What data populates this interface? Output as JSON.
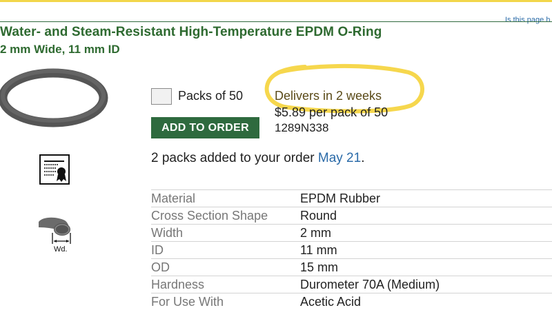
{
  "header": {
    "help_link": "Is this page h"
  },
  "product": {
    "title": "Water- and Steam-Resistant High-Temperature EPDM O-Ring",
    "subtitle": "2 mm Wide, 11 mm ID",
    "profile_label": "Wd."
  },
  "order": {
    "packs_label": "Packs of 50",
    "delivery": "Delivers in 2 weeks",
    "price": "$5.89 per pack of 50",
    "part_number": "1289N338",
    "add_button_label": "ADD TO ORDER",
    "added_prefix": "2 packs added to your order",
    "added_date": "May 21",
    "added_suffix": "."
  },
  "specs": [
    {
      "name": "Material",
      "value": "EPDM Rubber"
    },
    {
      "name": "Cross Section Shape",
      "value": "Round"
    },
    {
      "name": "Width",
      "value": "2 mm"
    },
    {
      "name": "ID",
      "value": "11 mm"
    },
    {
      "name": "OD",
      "value": "15 mm"
    },
    {
      "name": "Hardness",
      "value": "Durometer 70A (Medium)"
    },
    {
      "name": "For Use With",
      "value": "Acetic Acid"
    }
  ],
  "colors": {
    "title_green": "#2e6a30",
    "button_green": "#2e6a3e",
    "link_blue": "#2a6aa8",
    "highlight_yellow": "#f5d33a"
  },
  "icons": [
    "o-ring-image",
    "certificate-icon",
    "cross-section-icon",
    "checkbox"
  ]
}
